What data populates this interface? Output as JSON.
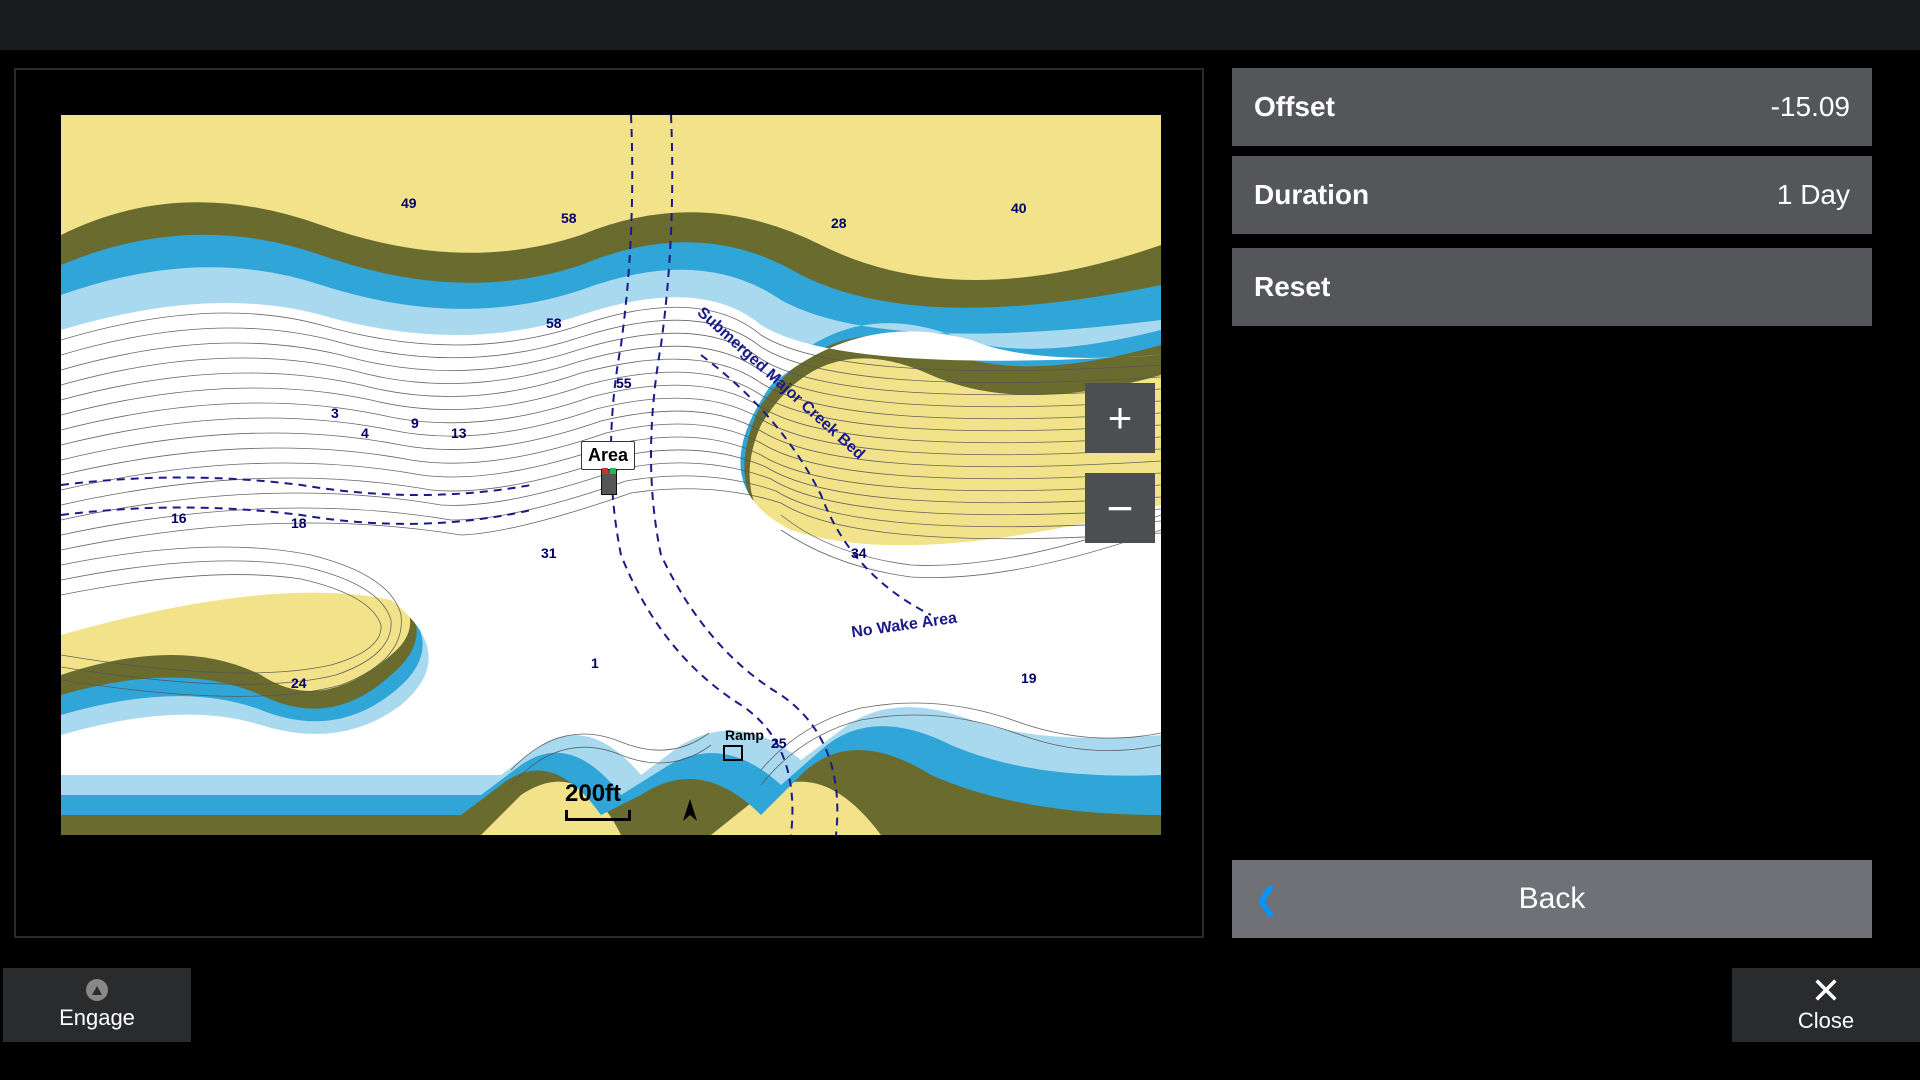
{
  "menu": {
    "offset": {
      "label": "Offset",
      "value": "-15.09"
    },
    "duration": {
      "label": "Duration",
      "value": "1 Day"
    },
    "reset": {
      "label": "Reset"
    },
    "back": {
      "label": "Back"
    }
  },
  "map": {
    "area_marker": "Area",
    "ramp_label": "Ramp",
    "no_wake": "No Wake Area",
    "creek_bed": "Submerged Major Creek Bed",
    "scale": "200ft",
    "zoom_in": "+",
    "zoom_out": "−",
    "depths": {
      "d1": "49",
      "d2": "58",
      "d3": "28",
      "d4": "40",
      "d5": "55",
      "d6": "58",
      "d7": "16",
      "d8": "19",
      "d9": "24",
      "d10": "25",
      "d11": "31",
      "d12": "34",
      "d13": "3",
      "d14": "4",
      "d15": "18",
      "d16": "9",
      "d17": "13",
      "d18": "1"
    }
  },
  "footer": {
    "engage": "Engage",
    "close": "Close"
  }
}
